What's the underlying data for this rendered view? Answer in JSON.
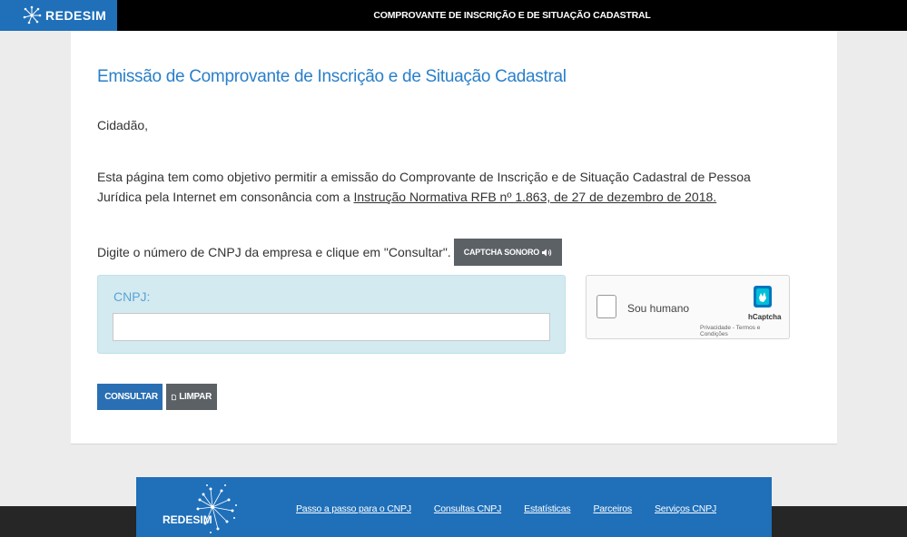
{
  "header": {
    "brand": "REDESIM",
    "title": "COMPROVANTE DE INSCRIÇÃO E DE SITUAÇÃO CADASTRAL"
  },
  "main": {
    "heading": "Emissão de Comprovante de Inscrição e de Situação Cadastral",
    "greeting": "Cidadão,",
    "description_pre": "Esta página tem como objetivo permitir a emissão do Comprovante de Inscrição e de Situação Cadastral de Pessoa Jurídica pela Internet em consonância com a ",
    "description_link": "Instrução Normativa RFB nº 1.863, de 27 de dezembro de 2018.",
    "prompt": "Digite o número de CNPJ da empresa e clique em \"Consultar\".",
    "captcha_audio_label": "CAPTCHA SONORO",
    "cnpj_label": "CNPJ:",
    "cnpj_value": "",
    "consultar_label": "CONSULTAR",
    "limpar_label": "LIMPAR"
  },
  "hcaptcha": {
    "checkbox_label": "Sou humano",
    "brand": "hCaptcha",
    "links": "Privacidade - Termos e Condições"
  },
  "footer": {
    "brand": "REDESIM",
    "links": [
      "Passo a passo para o CNPJ",
      "Consultas CNPJ",
      "Estatísticas",
      "Parceiros",
      "Serviços CNPJ"
    ]
  },
  "colors": {
    "header_bg": "#000000",
    "brand_blue": "#1f6fb9",
    "heading_blue": "#2a7fc9",
    "cnpj_panel": "#d3eaf0",
    "button_primary": "#2a6fb3",
    "button_secondary": "#5c6166"
  }
}
